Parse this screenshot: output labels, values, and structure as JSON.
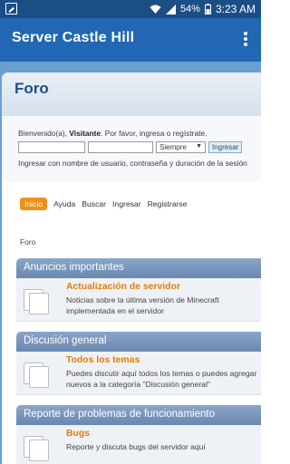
{
  "status_bar": {
    "battery_percent": "54%",
    "time": "3:23 AM"
  },
  "app_bar": {
    "title": "Server Castle Hill"
  },
  "page": {
    "title": "Foro"
  },
  "login": {
    "welcome_prefix": "Bienvenido(a), ",
    "username_label": "Visitante",
    "welcome_suffix": ". Por favor, ingresa o regístrate.",
    "username_value": "",
    "password_value": "",
    "duration_selected": "Siempre",
    "submit_label": "Ingresar",
    "hint": "Ingresar con nombre de usuario, contraseña y duración de la sesión"
  },
  "nav": {
    "home": "Inicio",
    "help": "Ayuda",
    "search": "Buscar",
    "login": "Ingresar",
    "register": "Registrarse"
  },
  "breadcrumb": "Foro",
  "categories": [
    {
      "name": "Anuncios importantes",
      "board": {
        "title": "Actualización de servidor",
        "description": "Noticias sobre la última versión de Minecraft implementada en el servidor"
      }
    },
    {
      "name": "Discusión general",
      "board": {
        "title": "Todos los temas",
        "description": "Puedes discutir aquí todos los temas o puedes agregar nuevos a la categoría \"Discusión general\""
      }
    },
    {
      "name": "Reporte de problemas de funcionamiento",
      "board": {
        "title": "Bugs",
        "description": "Reporte y discuta bugs del servidor aquí"
      }
    }
  ]
}
